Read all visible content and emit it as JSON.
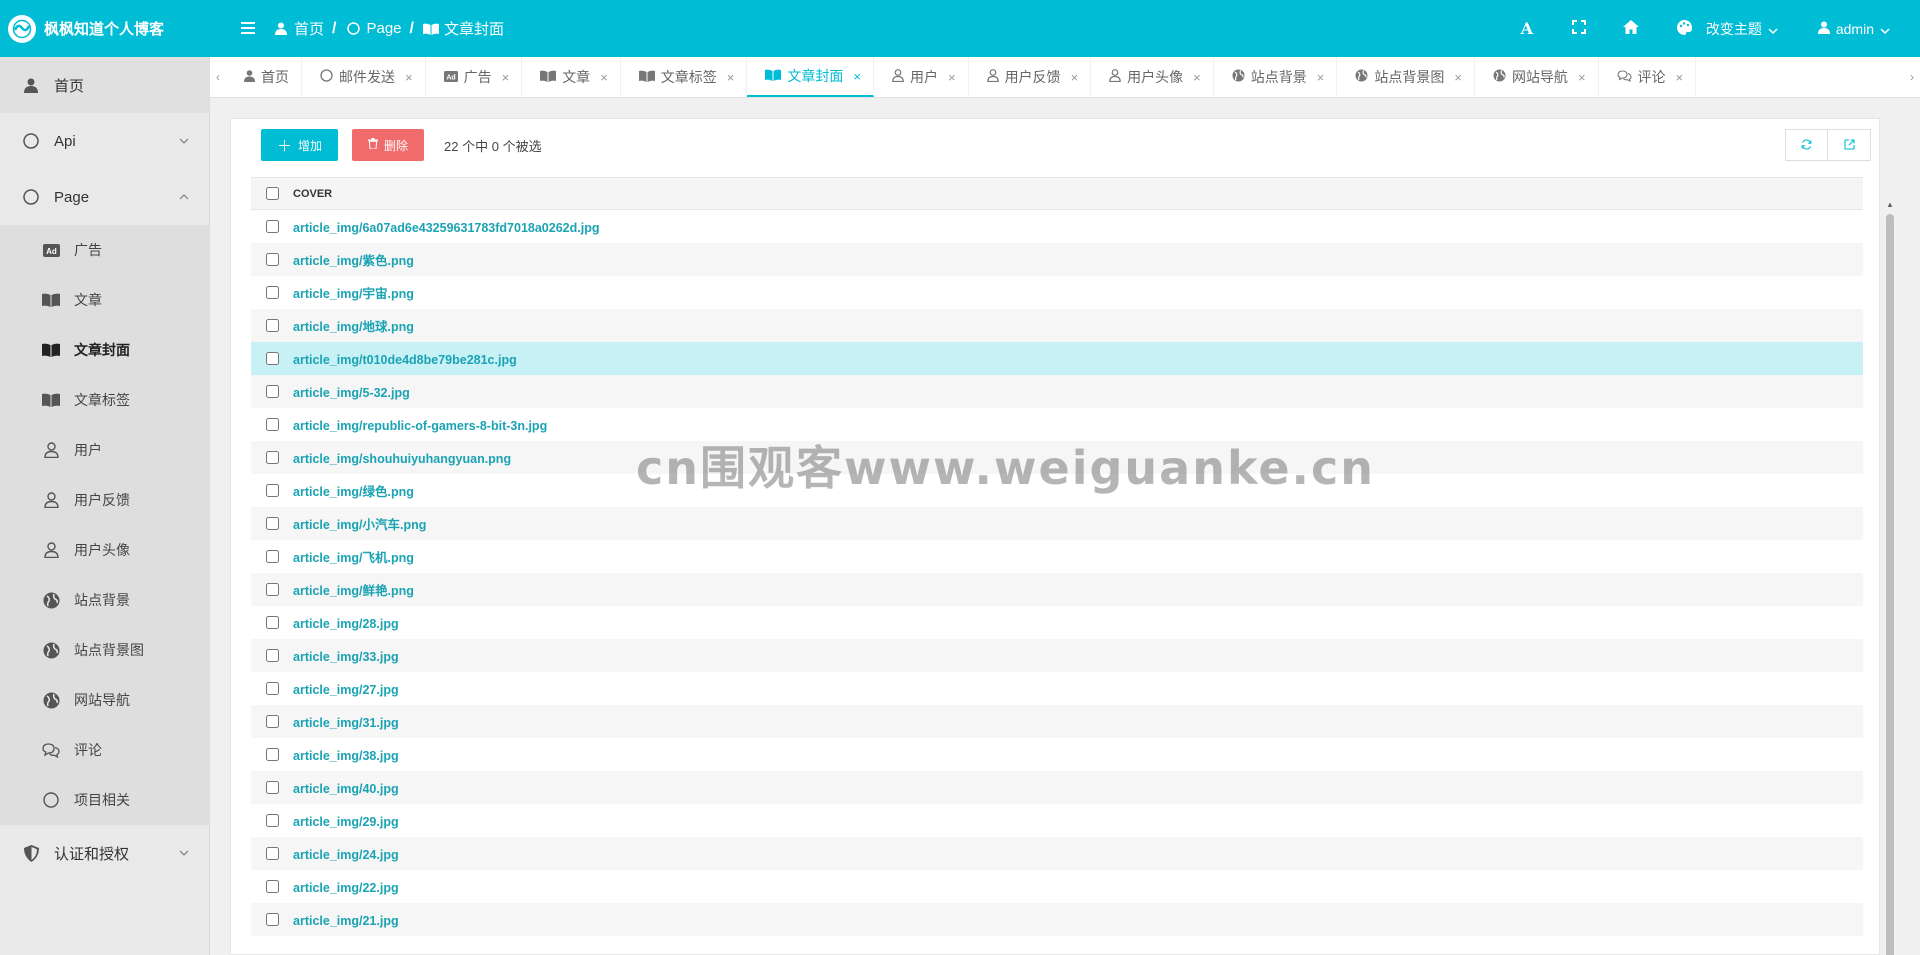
{
  "header": {
    "title": "枫枫知道个人博客",
    "breadcrumbs": [
      "首页",
      "Page",
      "文章封面"
    ],
    "theme_label": "改变主题",
    "user_label": "admin"
  },
  "sidebar": {
    "home": "首页",
    "api": "Api",
    "page": "Page",
    "sub_items": [
      "广告",
      "文章",
      "文章封面",
      "文章标签",
      "用户",
      "用户反馈",
      "用户头像",
      "站点背景",
      "站点背景图",
      "网站导航",
      "评论",
      "项目相关"
    ],
    "auth": "认证和授权"
  },
  "tabs": [
    "首页",
    "邮件发送",
    "广告",
    "文章",
    "文章标签",
    "文章封面",
    "用户",
    "用户反馈",
    "用户头像",
    "站点背景",
    "站点背景图",
    "网站导航",
    "评论"
  ],
  "toolbar": {
    "add_label": "增加",
    "delete_label": "删除",
    "selection_text": "22 个中 0 个被选"
  },
  "table": {
    "header": "COVER",
    "rows": [
      "article_img/6a07ad6e43259631783fd7018a0262d.jpg",
      "article_img/紫色.png",
      "article_img/宇宙.png",
      "article_img/地球.png",
      "article_img/t010de4d8be79be281c.jpg",
      "article_img/5-32.jpg",
      "article_img/republic-of-gamers-8-bit-3n.jpg",
      "article_img/shouhuiyuhangyuan.png",
      "article_img/绿色.png",
      "article_img/小汽车.png",
      "article_img/飞机.png",
      "article_img/鲜艳.png",
      "article_img/28.jpg",
      "article_img/33.jpg",
      "article_img/27.jpg",
      "article_img/31.jpg",
      "article_img/38.jpg",
      "article_img/40.jpg",
      "article_img/29.jpg",
      "article_img/24.jpg",
      "article_img/22.jpg",
      "article_img/21.jpg"
    ]
  },
  "watermark": "cn围观客www.weiguanke.cn",
  "colors": {
    "primary": "#00bcd4",
    "danger": "#f06b6b",
    "link": "#1aa3b3",
    "highlight_row": "#c8f1f6"
  }
}
